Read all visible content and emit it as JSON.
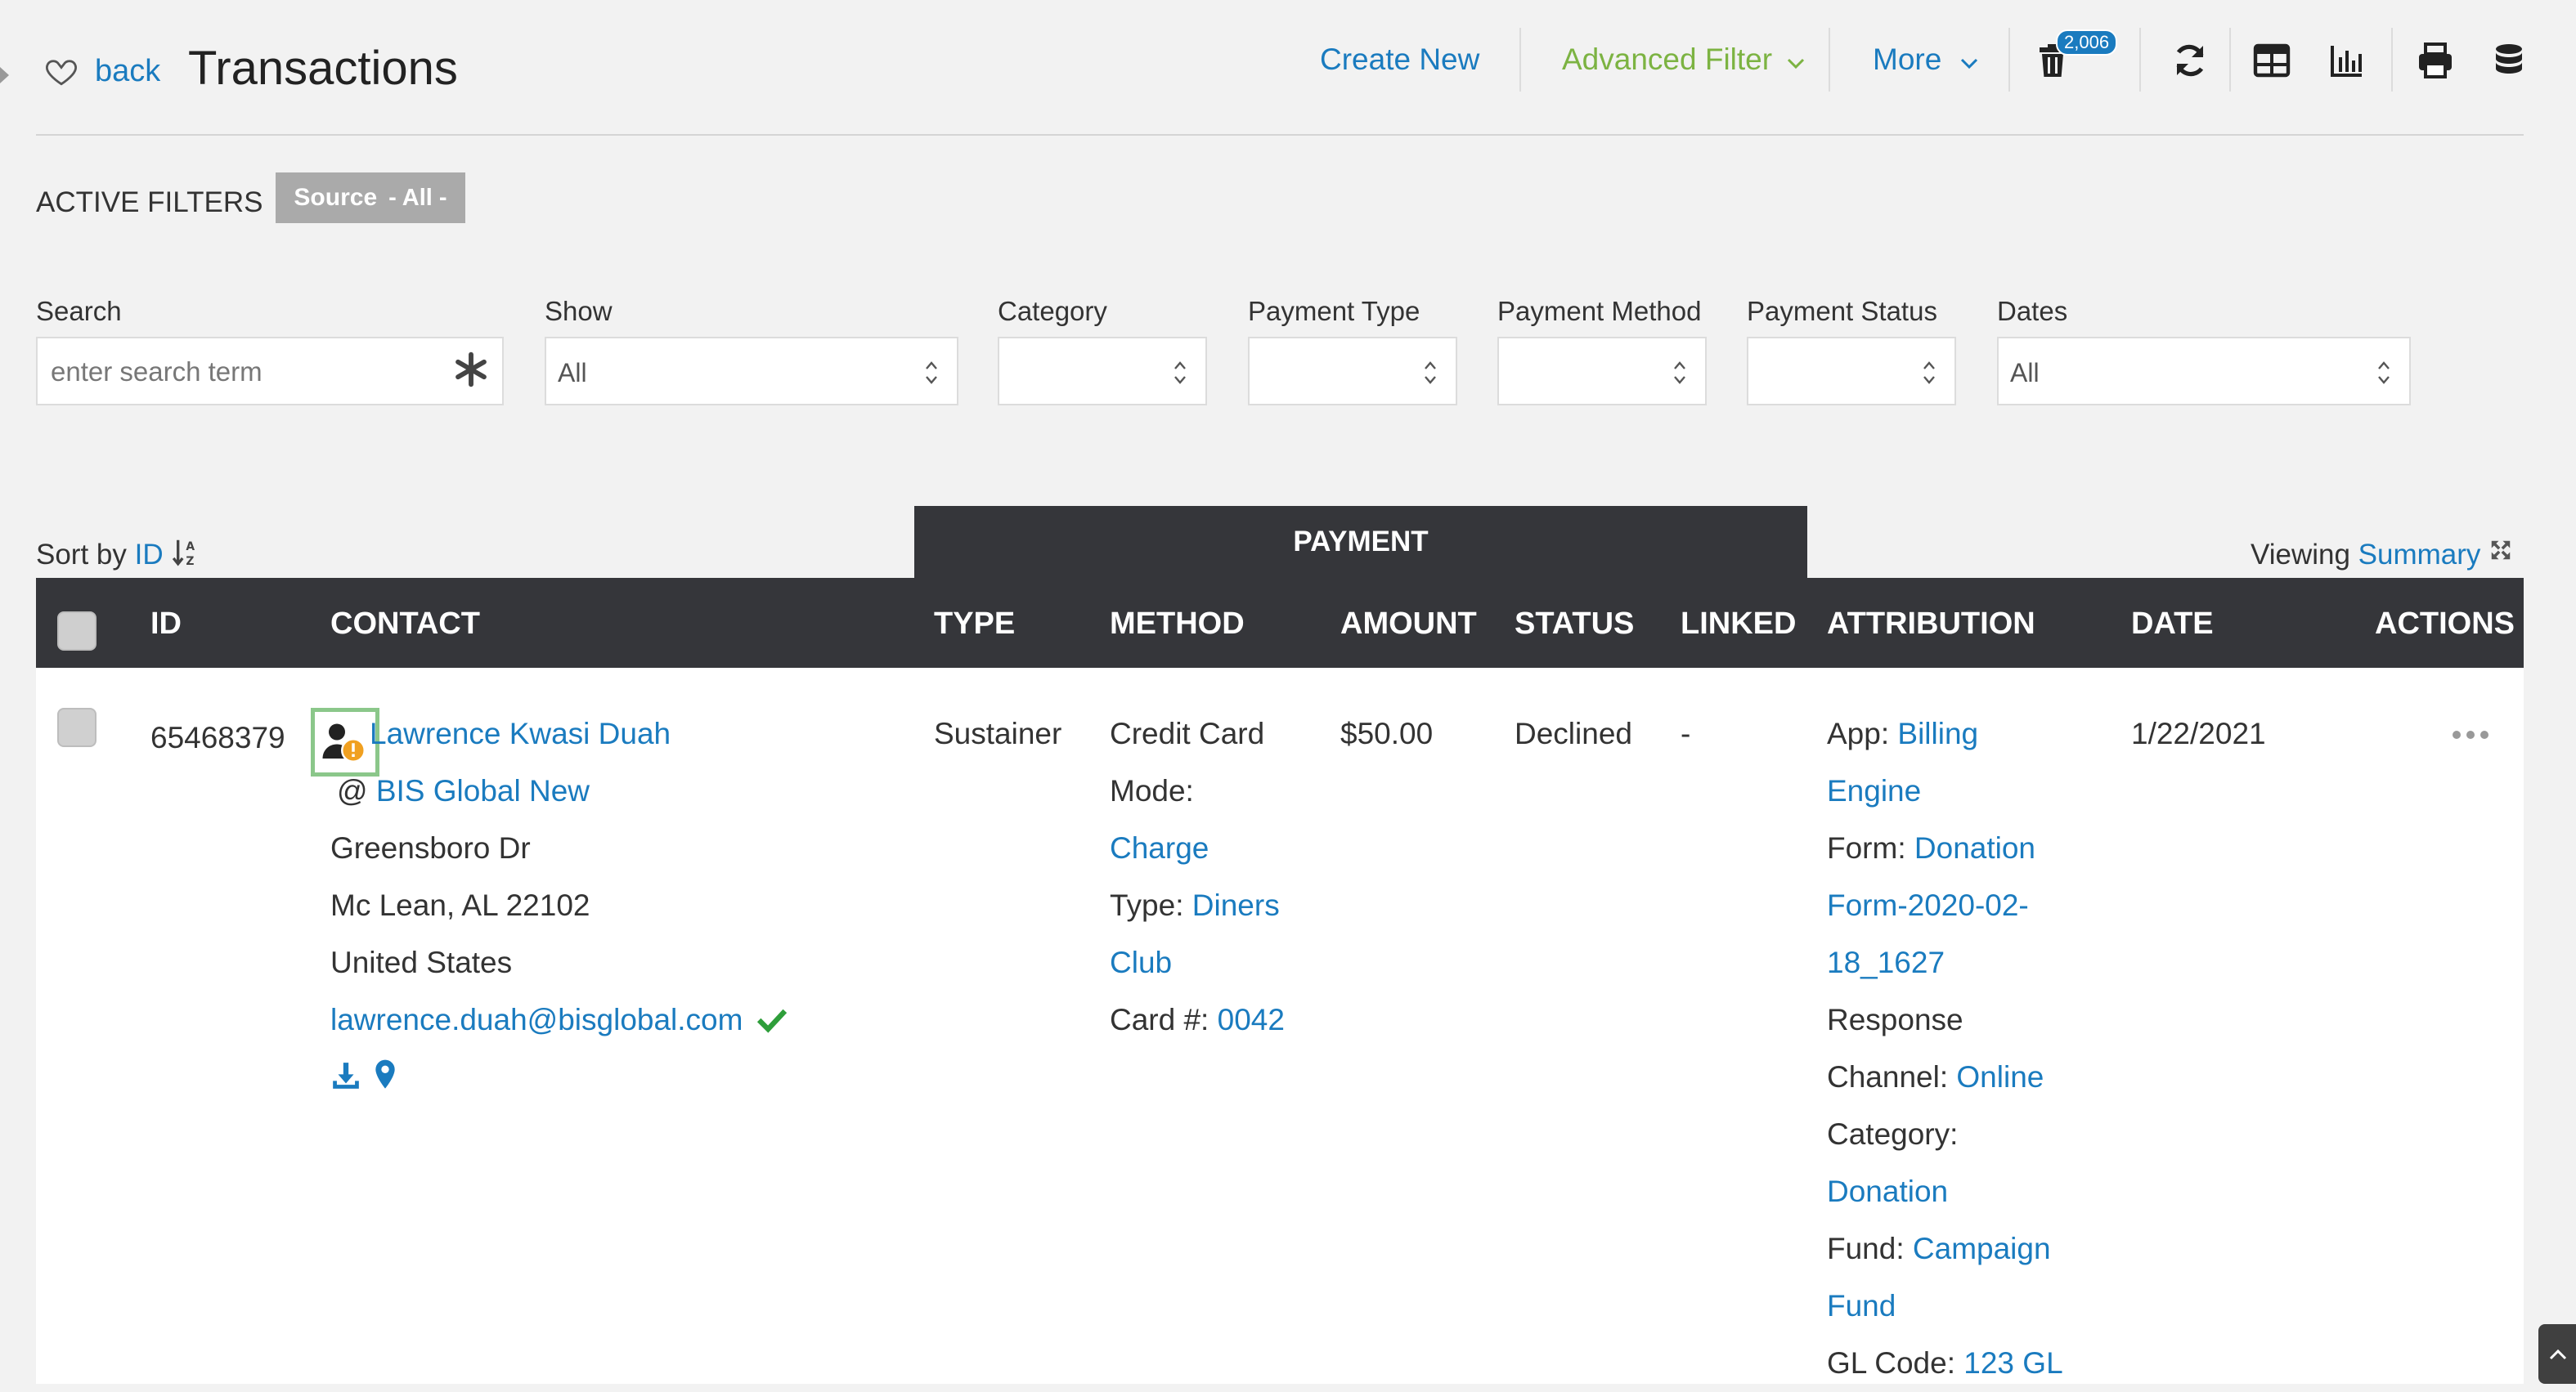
{
  "header": {
    "back_label": "back",
    "title": "Transactions",
    "create_new": "Create New",
    "advanced_filter": "Advanced Filter",
    "more": "More",
    "trash_count": "2,006"
  },
  "active_filters": {
    "label": "ACTIVE FILTERS",
    "chip_field": "Source",
    "chip_value": "- All -"
  },
  "filters": {
    "search": {
      "label": "Search",
      "placeholder": "enter search term"
    },
    "show": {
      "label": "Show",
      "value": "All"
    },
    "category": {
      "label": "Category",
      "value": ""
    },
    "payment_type": {
      "label": "Payment Type",
      "value": ""
    },
    "payment_method": {
      "label": "Payment Method",
      "value": ""
    },
    "payment_status": {
      "label": "Payment Status",
      "value": ""
    },
    "dates": {
      "label": "Dates",
      "value": "All"
    }
  },
  "sort": {
    "label": "Sort by",
    "field": "ID"
  },
  "viewing": {
    "label": "Viewing",
    "mode": "Summary"
  },
  "group_header": "PAYMENT",
  "columns": [
    "ID",
    "CONTACT",
    "TYPE",
    "METHOD",
    "AMOUNT",
    "STATUS",
    "LINKED",
    "ATTRIBUTION",
    "DATE",
    "ACTIONS"
  ],
  "row": {
    "id": "65468379",
    "contact": {
      "name": "Lawrence Kwasi Duah",
      "at": "@",
      "org": "BIS Global New",
      "street": "Greensboro Dr",
      "city_line": "Mc Lean, AL 22102",
      "country": "United States",
      "email": "lawrence.duah@bisglobal.com"
    },
    "type": "Sustainer",
    "method": {
      "line1": "Credit Card",
      "mode_label": "Mode:",
      "mode_value": "Charge",
      "type_label": "Type:",
      "type_value_1": "Diners",
      "type_value_2": "Club",
      "card_label": "Card #:",
      "card_value": "0042"
    },
    "amount": "$50.00",
    "status": "Declined",
    "linked": "-",
    "attribution": {
      "app_label": "App:",
      "app_value_1": "Billing",
      "app_value_2": "Engine",
      "form_label": "Form:",
      "form_value_1": "Donation",
      "form_value_2": "Form-2020-02-",
      "form_value_3": "18_1627",
      "response_label": "Response",
      "channel_label": "Channel:",
      "channel_value": "Online",
      "category_label": "Category:",
      "category_value": "Donation",
      "fund_label": "Fund:",
      "fund_value_1": "Campaign",
      "fund_value_2": "Fund",
      "gl_label": "GL Code:",
      "gl_value": "123 GL"
    },
    "date": "1/22/2021"
  },
  "colors": {
    "link": "#1a7bbf",
    "accent_green": "#7cb342",
    "header_dark": "#35363a",
    "badge": "#1a7bbf",
    "warning": "#f0a020",
    "verified": "#2e9e3a"
  }
}
